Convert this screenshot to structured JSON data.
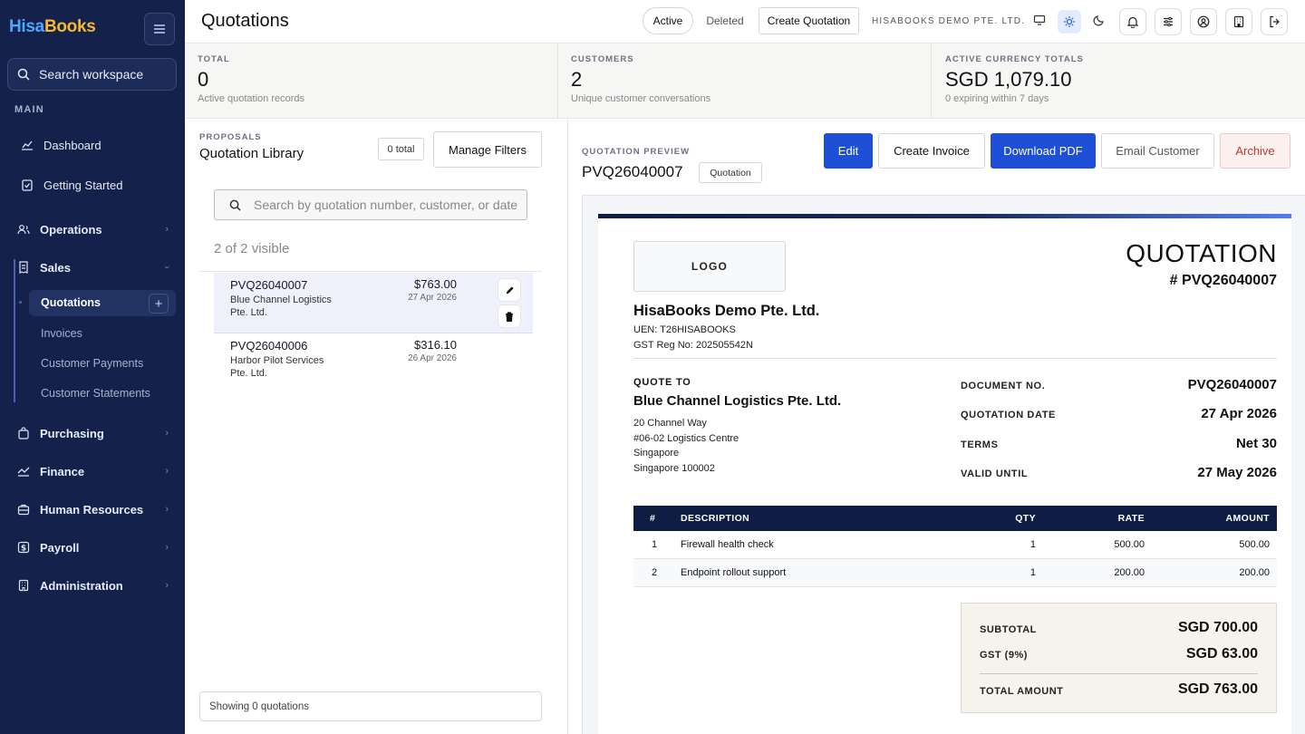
{
  "brand": {
    "part1": "Hisa",
    "part2": "Books"
  },
  "sidebar": {
    "search_placeholder": "Search workspace",
    "section_main": "MAIN",
    "items": {
      "dashboard": "Dashboard",
      "getting_started": "Getting Started",
      "operations": "Operations",
      "sales": "Sales",
      "quotations": "Quotations",
      "invoices": "Invoices",
      "customer_payments": "Customer Payments",
      "customer_statements": "Customer Statements",
      "purchasing": "Purchasing",
      "finance": "Finance",
      "human_resources": "Human Resources",
      "payroll": "Payroll",
      "administration": "Administration"
    }
  },
  "topbar": {
    "title": "Quotations",
    "active": "Active",
    "deleted": "Deleted",
    "create": "Create Quotation",
    "company": "HISABOOKS DEMO PTE. LTD."
  },
  "stats": {
    "total_label": "TOTAL",
    "total_value": "0",
    "total_sub": "Active quotation records",
    "customers_label": "CUSTOMERS",
    "customers_value": "2",
    "customers_sub": "Unique customer conversations",
    "currency_label": "ACTIVE CURRENCY TOTALS",
    "currency_value": "SGD 1,079.10",
    "currency_sub": "0 expiring within 7 days"
  },
  "library": {
    "eyebrow": "PROPOSALS",
    "title": "Quotation Library",
    "count_badge": "0 total",
    "manage_filters": "Manage Filters",
    "search_placeholder": "Search by quotation number, customer, or date",
    "visible_count": "2 of 2 visible",
    "rows": [
      {
        "number": "PVQ26040007",
        "customer_l1": "Blue Channel Logistics",
        "customer_l2": "Pte. Ltd.",
        "amount": "$763.00",
        "date": "27 Apr 2026"
      },
      {
        "number": "PVQ26040006",
        "customer_l1": "Harbor Pilot Services",
        "customer_l2": "Pte. Ltd.",
        "amount": "$316.10",
        "date": "26 Apr 2026"
      }
    ],
    "footer": "Showing 0 quotations"
  },
  "preview": {
    "eyebrow": "QUOTATION PREVIEW",
    "number": "PVQ26040007",
    "type_badge": "Quotation",
    "actions": {
      "edit": "Edit",
      "create_invoice": "Create Invoice",
      "download": "Download PDF",
      "email": "Email Customer",
      "archive": "Archive"
    }
  },
  "document": {
    "logo": "LOGO",
    "heading": "QUOTATION",
    "number_line": "# PVQ26040007",
    "company": "HisaBooks Demo Pte. Ltd.",
    "uen": "UEN: T26HISABOOKS",
    "gst_reg": "GST Reg No: 202505542N",
    "quote_to_label": "QUOTE TO",
    "customer": "Blue Channel Logistics Pte. Ltd.",
    "address": [
      "20 Channel Way",
      "#06-02 Logistics Centre",
      "Singapore",
      "Singapore 100002"
    ],
    "meta": [
      {
        "label": "DOCUMENT NO.",
        "value": "PVQ26040007"
      },
      {
        "label": "QUOTATION DATE",
        "value": "27 Apr 2026"
      },
      {
        "label": "TERMS",
        "value": "Net 30"
      },
      {
        "label": "VALID UNTIL",
        "value": "27 May 2026"
      }
    ],
    "table_headers": {
      "num": "#",
      "desc": "DESCRIPTION",
      "qty": "QTY",
      "rate": "RATE",
      "amount": "AMOUNT"
    },
    "lines": [
      {
        "num": "1",
        "desc": "Firewall health check",
        "qty": "1",
        "rate": "500.00",
        "amount": "500.00"
      },
      {
        "num": "2",
        "desc": "Endpoint rollout support",
        "qty": "1",
        "rate": "200.00",
        "amount": "200.00"
      }
    ],
    "subtotal_label": "SUBTOTAL",
    "subtotal": "SGD 700.00",
    "gst_label": "GST (9%)",
    "gst": "SGD 63.00",
    "total_label": "TOTAL AMOUNT",
    "total": "SGD 763.00"
  },
  "colors": {
    "sidebar": "#13214b",
    "accent": "#1f4fd6",
    "archive": "#c0392b"
  }
}
